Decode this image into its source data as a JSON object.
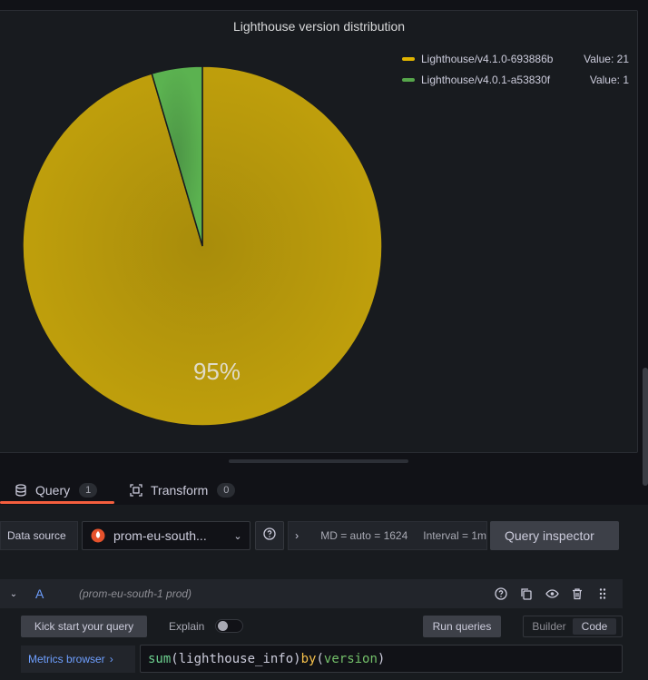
{
  "panel": {
    "title": "Lighthouse version distribution",
    "center_label": "95%"
  },
  "chart_data": {
    "type": "pie",
    "title": "Lighthouse version distribution",
    "slices": [
      {
        "name": "Lighthouse/v4.1.0-693886b",
        "value": 21,
        "color": "#b99c0c"
      },
      {
        "name": "Lighthouse/v4.0.1-a53830f",
        "value": 1,
        "color": "#56a64b"
      }
    ],
    "legend": {
      "placement": "top-right",
      "items": [
        {
          "name": "Lighthouse/v4.1.0-693886b",
          "value_text": "Value: 21",
          "color": "#e0b400"
        },
        {
          "name": "Lighthouse/v4.0.1-a53830f",
          "value_text": "Value: 1",
          "color": "#56a64b"
        }
      ]
    }
  },
  "tabs": {
    "query": {
      "label": "Query",
      "count": "1",
      "icon": "database-icon"
    },
    "transform": {
      "label": "Transform",
      "count": "0",
      "icon": "transform-icon"
    }
  },
  "options": {
    "data_source_label": "Data source",
    "data_source_name": "prom-eu-south...",
    "data_source_icon": "prometheus-icon",
    "md_text": "MD = auto = 1624",
    "interval_text": "Interval = 1m",
    "query_inspector_label": "Query inspector"
  },
  "query_row": {
    "letter": "A",
    "datasource_hint": "(prom-eu-south-1 prod)"
  },
  "editor": {
    "kick_start_label": "Kick start your query",
    "explain_label": "Explain",
    "run_queries_label": "Run queries",
    "mode_builder": "Builder",
    "mode_code": "Code",
    "metrics_browser_label": "Metrics browser",
    "query": {
      "fn": "sum",
      "open": "(",
      "metric": "lighthouse_info",
      "close": ")",
      "kw": "by",
      "open2": "(",
      "label": "version",
      "close2": ")"
    }
  }
}
